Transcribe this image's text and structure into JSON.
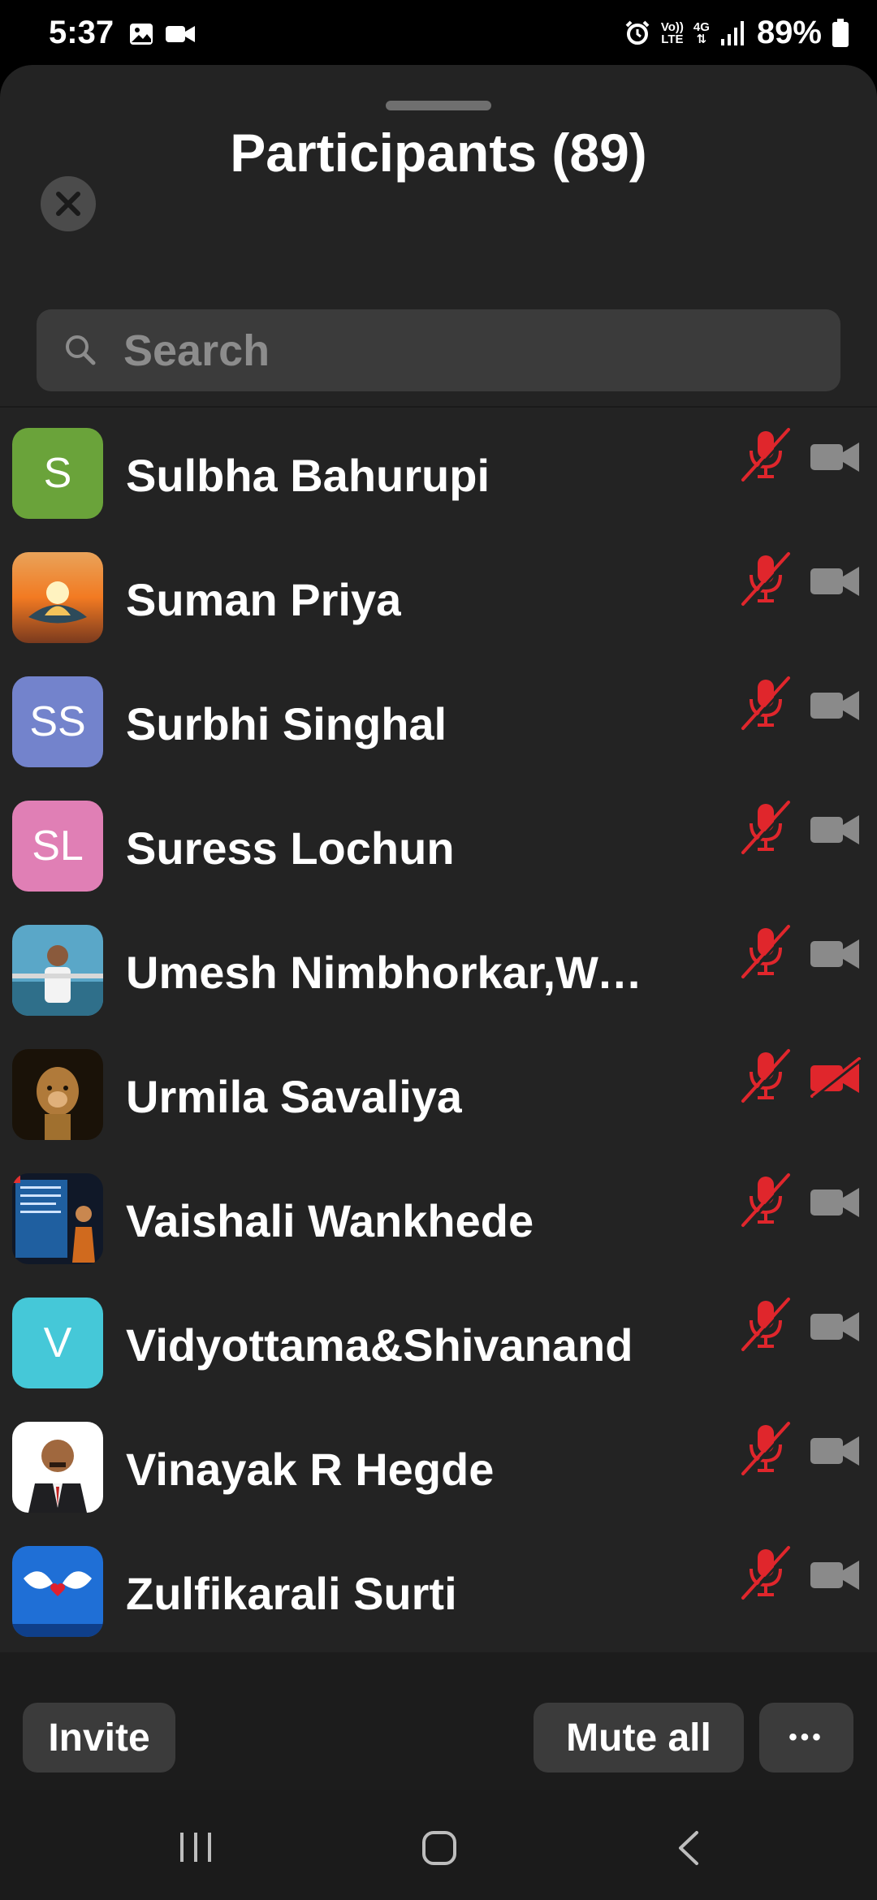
{
  "status_bar": {
    "time": "5:37",
    "battery": "89%",
    "network_volte": "Vo))",
    "network_lte": "LTE",
    "network_4g": "4G"
  },
  "sheet": {
    "title": "Participants (89)",
    "close_icon": "close-icon"
  },
  "search": {
    "placeholder": "Search"
  },
  "participants": [
    {
      "name": "Sulbha Bahurupi",
      "avatar_initials": "S",
      "avatar_color": "#6aa33a",
      "mic": "muted",
      "camera": "off"
    },
    {
      "name": "Suman Priya",
      "avatar_initials": "",
      "avatar_kind": "photo-lotus-sunset",
      "mic": "muted",
      "camera": "off"
    },
    {
      "name": "Surbhi Singhal",
      "avatar_initials": "SS",
      "avatar_color": "#7383cc",
      "mic": "muted",
      "camera": "off"
    },
    {
      "name": "Suress Lochun",
      "avatar_initials": "SL",
      "avatar_color": "#e07fb5",
      "mic": "muted",
      "camera": "off"
    },
    {
      "name": "Umesh Nimbhorkar,War...",
      "avatar_initials": "",
      "avatar_kind": "photo-man-waterfront",
      "mic": "muted",
      "camera": "off"
    },
    {
      "name": "Urmila Savaliya",
      "avatar_initials": "",
      "avatar_kind": "photo-lion-cub",
      "mic": "muted",
      "camera": "blocked"
    },
    {
      "name": "Vaishali Wankhede",
      "avatar_initials": "",
      "avatar_kind": "photo-text-poster",
      "mic": "muted",
      "camera": "off"
    },
    {
      "name": "Vidyottama&Shivanand",
      "avatar_initials": "V",
      "avatar_color": "#45c8d8",
      "mic": "muted",
      "camera": "off"
    },
    {
      "name": "Vinayak R Hegde",
      "avatar_initials": "",
      "avatar_kind": "photo-man-portrait",
      "mic": "muted",
      "camera": "off"
    },
    {
      "name": "Zulfikarali Surti",
      "avatar_initials": "",
      "avatar_kind": "photo-doves-heart",
      "mic": "muted",
      "camera": "off"
    }
  ],
  "bottom_bar": {
    "invite_label": "Invite",
    "mute_all_label": "Mute all",
    "more_label": "•••"
  },
  "colors": {
    "muted_red": "#e0262c",
    "camera_gray": "#8a8a8a",
    "sheet_bg": "#232323"
  }
}
